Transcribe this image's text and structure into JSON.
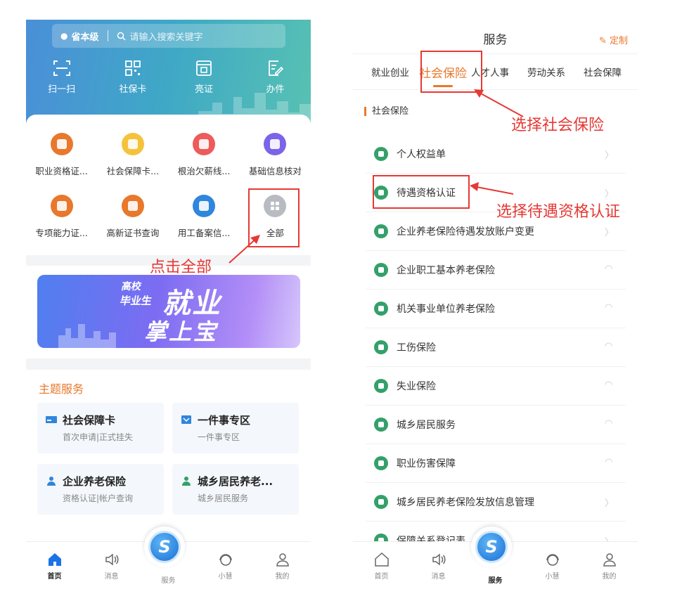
{
  "left": {
    "search": {
      "location": "省本级",
      "placeholder": "请输入搜索关键字"
    },
    "quick_actions": [
      {
        "label": "扫一扫",
        "icon": "scan-icon"
      },
      {
        "label": "社保卡",
        "icon": "qr-card-icon"
      },
      {
        "label": "亮证",
        "icon": "certificate-icon"
      },
      {
        "label": "办件",
        "icon": "edit-doc-icon"
      }
    ],
    "grid_row1": [
      {
        "label": "职业资格证...",
        "color": "#e8782c"
      },
      {
        "label": "社会保障卡...",
        "color": "#f5c33b"
      },
      {
        "label": "根治欠薪线...",
        "color": "#ef5a5a"
      },
      {
        "label": "基础信息核对",
        "color": "#7b64e8"
      }
    ],
    "grid_row2": [
      {
        "label": "专项能力证...",
        "color": "#e8782c"
      },
      {
        "label": "高新证书查询",
        "color": "#e8782c"
      },
      {
        "label": "用工备案信...",
        "color": "#2f86dd"
      },
      {
        "label": "全部",
        "color": "#b8bcc2"
      }
    ],
    "banner": {
      "line1": "毕业生",
      "line2": "高校",
      "line3": "就业",
      "line4": "掌上宝"
    },
    "section_title": "主题服务",
    "tiles": [
      {
        "title": "社会保障卡",
        "sub": "首次申请|正式挂失"
      },
      {
        "title": "一件事专区",
        "sub": "一件事专区"
      },
      {
        "title": "企业养老保险",
        "sub": "资格认证|帐户查询"
      },
      {
        "title": "城乡居民养老...",
        "sub": "城乡居民服务"
      }
    ],
    "annotation": "点击全部",
    "tabbar": [
      {
        "label": "首页",
        "active": true
      },
      {
        "label": "消息",
        "active": false
      },
      {
        "label": "服务",
        "active": false
      },
      {
        "label": "小慧",
        "active": false
      },
      {
        "label": "我的",
        "active": false
      }
    ]
  },
  "right": {
    "title": "服务",
    "custom": "定制",
    "tabs": [
      "就业创业",
      "社会保险",
      "人才人事",
      "劳动关系",
      "社会保障"
    ],
    "selected_tab": "社会保险",
    "sublabel": "社会保险",
    "rows": [
      "个人权益单",
      "待遇资格认证",
      "企业养老保险待遇发放账户变更",
      "企业职工基本养老保险",
      "机关事业单位养老保险",
      "工伤保险",
      "失业保险",
      "城乡居民服务",
      "职业伤害保障",
      "城乡居民养老保险发放信息管理",
      "保障关系登记表"
    ],
    "annotation_tab": "选择社会保险",
    "annotation_row": "选择待遇资格认证",
    "tabbar": [
      {
        "label": "首页",
        "active": false
      },
      {
        "label": "消息",
        "active": false
      },
      {
        "label": "服务",
        "active": true
      },
      {
        "label": "小慧",
        "active": false
      },
      {
        "label": "我的",
        "active": false
      }
    ]
  },
  "colors": {
    "accent": "#e8782c",
    "annotation": "#e53935",
    "hero_start": "#4a8fd8",
    "hero_end": "#58c2b2"
  }
}
